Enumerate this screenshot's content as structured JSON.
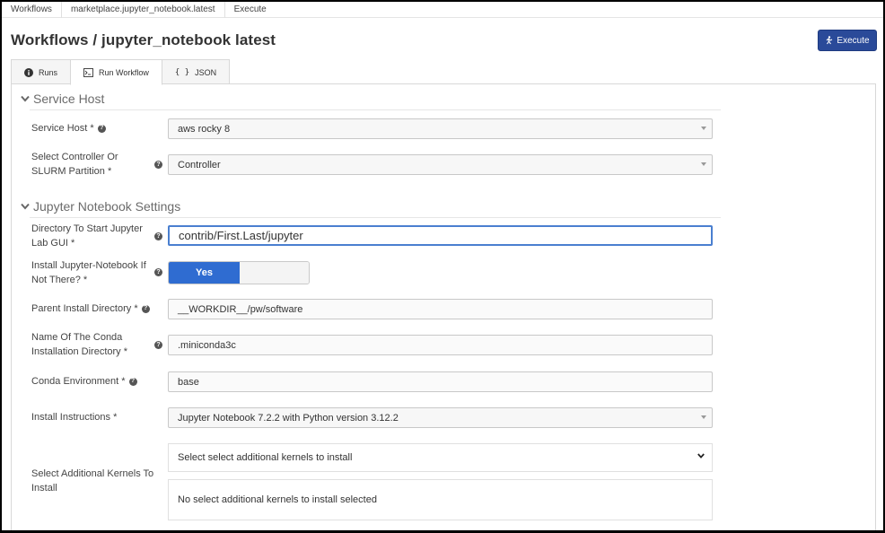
{
  "breadcrumbs": [
    "Workflows",
    "marketplace.jupyter_notebook.latest",
    "Execute"
  ],
  "page_title": "Workflows / jupyter_notebook latest",
  "execute_label": "Execute",
  "tabs": [
    {
      "label": "Runs",
      "icon": "info-icon"
    },
    {
      "label": "Run Workflow",
      "icon": "terminal-icon"
    },
    {
      "label": "JSON",
      "icon": "braces-icon"
    }
  ],
  "sections": {
    "service_host": "Service Host",
    "jupyter": "Jupyter Notebook Settings"
  },
  "fields": {
    "service_host": {
      "label": "Service Host *",
      "value": "aws rocky 8"
    },
    "controller": {
      "label_line1": "Select Controller Or",
      "label_line2": "SLURM Partition *",
      "value": "Controller"
    },
    "directory": {
      "label_line1": "Directory To Start Jupyter",
      "label_line2": "Lab GUI *",
      "value": "contrib/First.Last/jupyter"
    },
    "install_jupyter": {
      "label_line1": "Install Jupyter-Notebook If",
      "label_line2": "Not There? *",
      "value": "Yes"
    },
    "parent_dir": {
      "label": "Parent Install Directory *",
      "value": "__WORKDIR__/pw/software"
    },
    "conda_dir": {
      "label_line1": "Name Of The Conda",
      "label_line2": "Installation Directory *",
      "value": ".miniconda3c"
    },
    "conda_env": {
      "label": "Conda Environment *",
      "value": "base"
    },
    "install_instructions": {
      "label": "Install Instructions *",
      "value": "Jupyter Notebook 7.2.2 with Python version 3.12.2"
    },
    "kernels": {
      "label_line1": "Select Additional Kernels To",
      "label_line2": "Install",
      "placeholder": "Select select additional kernels to install",
      "empty_text": "No select additional kernels to install selected"
    }
  },
  "colors": {
    "primary": "#2a4a99",
    "toggle_on": "#2f6cd1",
    "focus": "#4a7fd0"
  }
}
